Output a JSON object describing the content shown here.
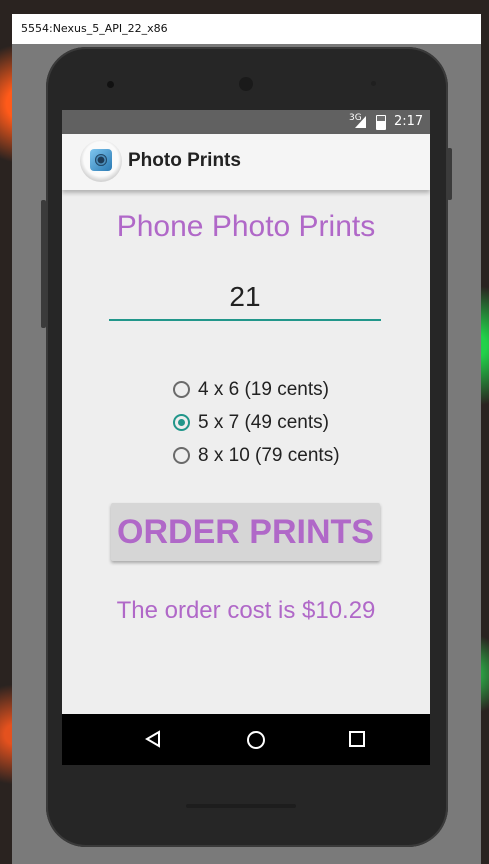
{
  "window": {
    "title": "5554:Nexus_5_API_22_x86"
  },
  "statusbar": {
    "network": "3G",
    "time": "2:17"
  },
  "appbar": {
    "title": "Photo Prints",
    "icon": "camera-app-icon"
  },
  "main": {
    "heading": "Phone Photo Prints",
    "quantity": "21",
    "options": [
      {
        "label": "4 x 6 (19 cents)",
        "checked": false
      },
      {
        "label": "5 x 7 (49 cents)",
        "checked": true
      },
      {
        "label": "8 x 10 (79 cents)",
        "checked": false
      }
    ],
    "order_button": "ORDER PRINTS",
    "cost_text": "The order cost is $10.29"
  },
  "navbar": {
    "back_icon": "back-triangle-icon",
    "home_icon": "home-circle-icon",
    "recent_icon": "recent-square-icon"
  },
  "colors": {
    "accent": "#21968a",
    "purple_text": "#b068c8",
    "statusbar": "#616161"
  }
}
